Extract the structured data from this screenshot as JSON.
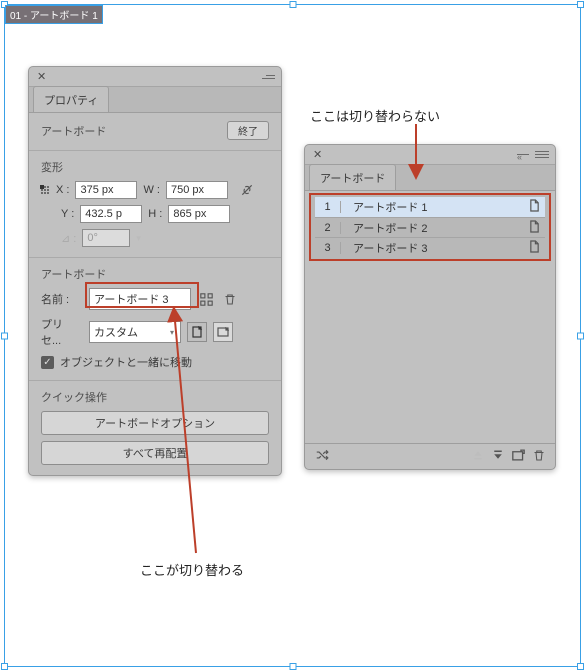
{
  "canvas_tag": "01 - アートボード 1",
  "annotations": {
    "top": "ここは切り替わらない",
    "bottom": "ここが切り替わる"
  },
  "properties_panel": {
    "tab_label": "プロパティ",
    "header": {
      "title": "アートボード",
      "done": "終了"
    },
    "transform": {
      "title": "変形",
      "x_label": "X :",
      "x": "375 px",
      "y_label": "Y :",
      "y": "432.5 p",
      "w_label": "W :",
      "w": "750 px",
      "h_label": "H :",
      "h": "865 px",
      "angle_label": "⊿ :",
      "angle": "0°"
    },
    "artboard": {
      "title": "アートボード",
      "name_label": "名前 :",
      "name_value": "アートボード 3",
      "preset_label": "プリセ...",
      "preset_value": "カスタム",
      "move_with_label": "オブジェクトと一緒に移動"
    },
    "quick": {
      "title": "クイック操作",
      "opt_btn": "アートボードオプション",
      "rearrange_btn": "すべて再配置"
    }
  },
  "artboards_panel": {
    "tab_label": "アートボード",
    "rows": [
      {
        "n": "1",
        "name": "アートボード 1",
        "selected": true
      },
      {
        "n": "2",
        "name": "アートボード 2",
        "selected": false
      },
      {
        "n": "3",
        "name": "アートボード 3",
        "selected": false
      }
    ]
  }
}
